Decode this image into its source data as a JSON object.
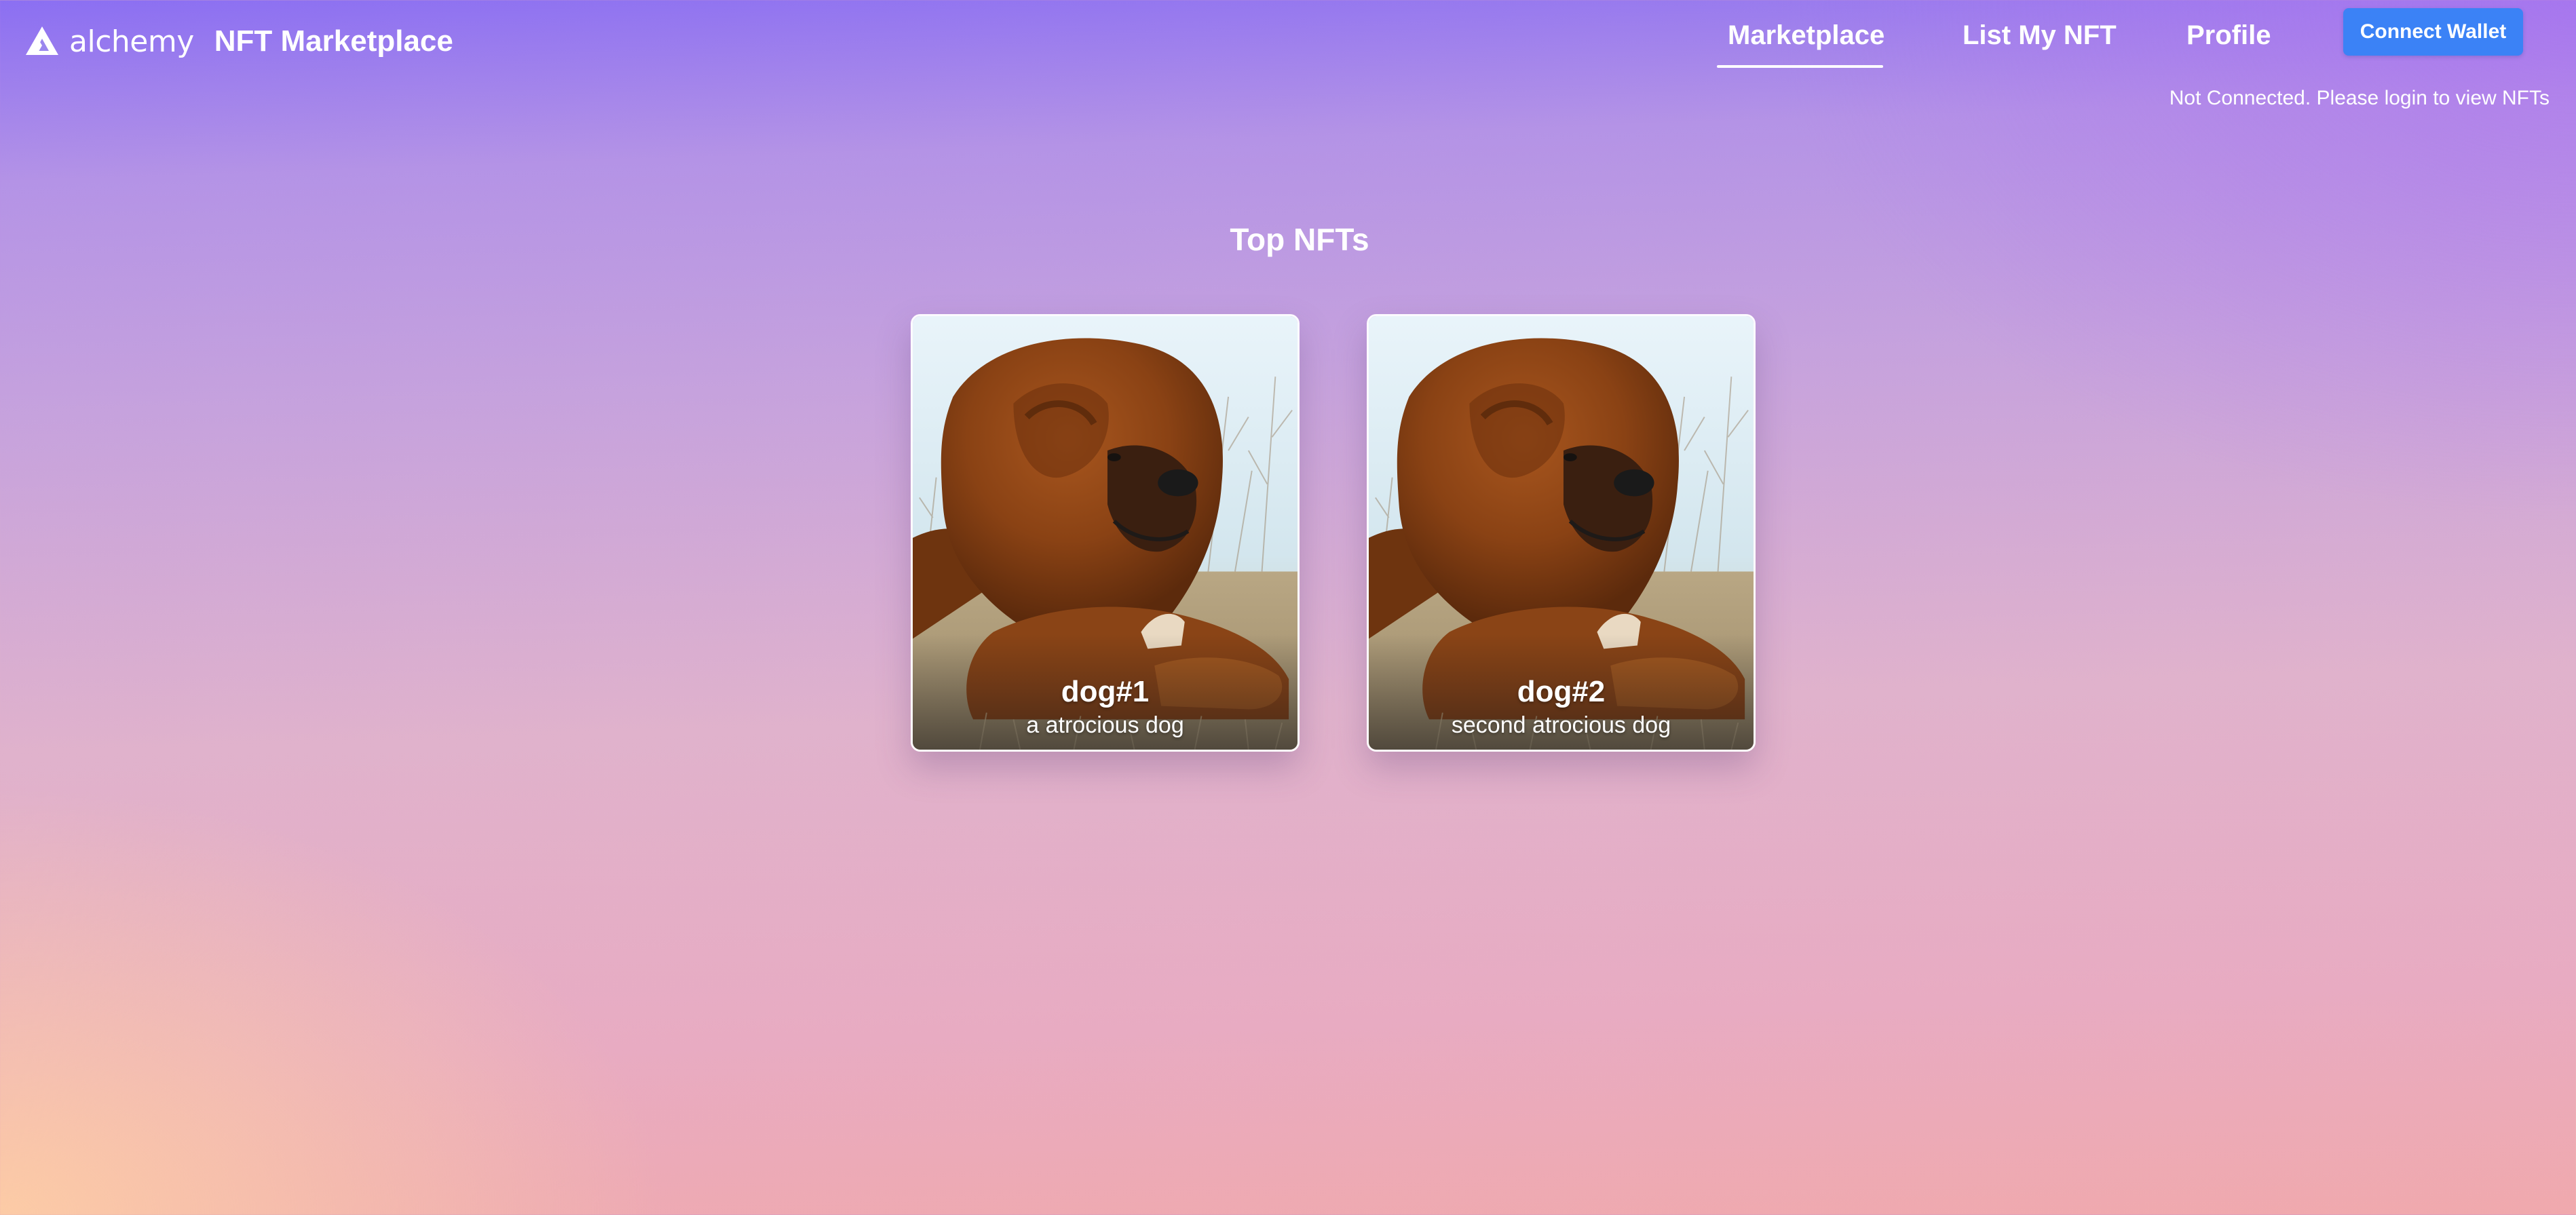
{
  "brand": {
    "wordmark": "alchemy",
    "title": "NFT Marketplace"
  },
  "nav": {
    "items": [
      {
        "label": "Marketplace",
        "active": true
      },
      {
        "label": "List My NFT",
        "active": false
      },
      {
        "label": "Profile",
        "active": false
      }
    ],
    "connect_button": "Connect Wallet",
    "status": "Not Connected. Please login to view NFTs"
  },
  "main": {
    "section_title": "Top NFTs",
    "nfts": [
      {
        "name": "dog#1",
        "description": "a atrocious dog"
      },
      {
        "name": "dog#2",
        "description": "second atrocious dog"
      }
    ]
  },
  "colors": {
    "accent": "#3b82f6",
    "background_top": "#8b6ff2",
    "background_bottom": "#f0a9ad"
  }
}
